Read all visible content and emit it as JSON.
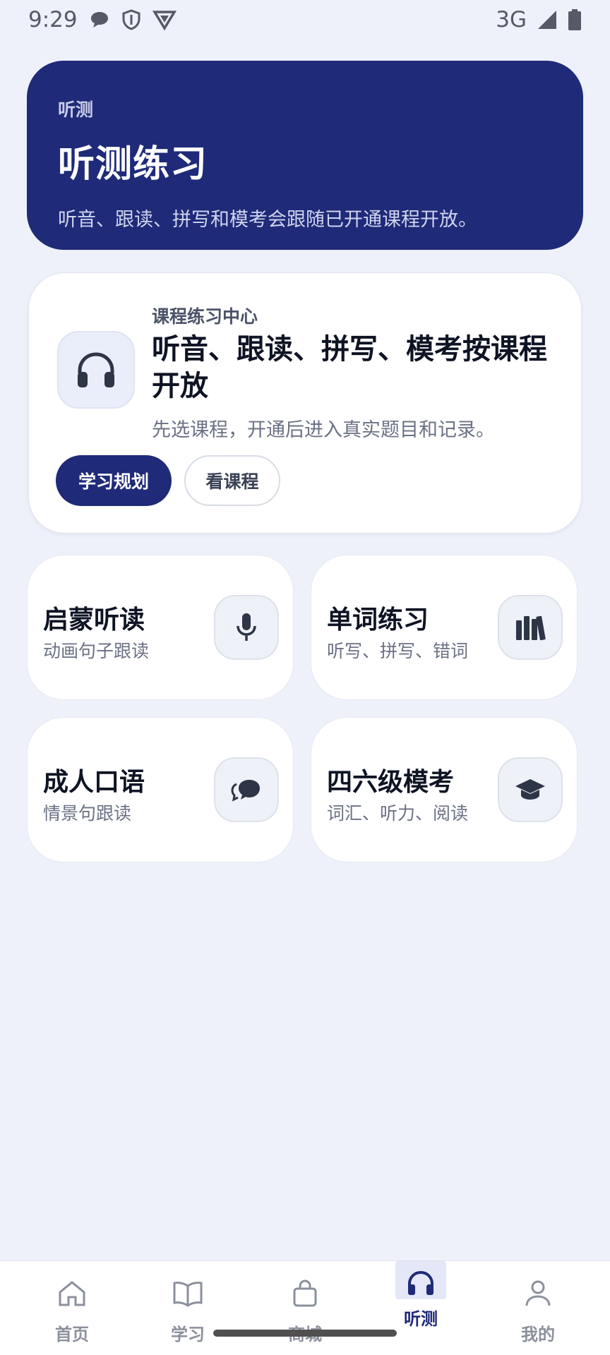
{
  "status_bar": {
    "time": "9:29",
    "network": "3G",
    "icons": [
      "chat-bubble-icon",
      "shield-icon",
      "vpn-icon",
      "signal-icon",
      "battery-icon"
    ]
  },
  "hero": {
    "tag": "听测",
    "title": "听测练习",
    "subtitle": "听音、跟读、拼写和模考会跟随已开通课程开放。"
  },
  "center_card": {
    "icon": "headphones-icon",
    "eyebrow": "课程练习中心",
    "title": "听音、跟读、拼写、模考按课程开放",
    "subtitle": "先选课程，开通后进入真实题目和记录。",
    "primary_button": "学习规划",
    "secondary_button": "看课程"
  },
  "practice_cards": [
    {
      "title": "启蒙听读",
      "subtitle": "动画句子跟读",
      "icon": "microphone-icon"
    },
    {
      "title": "单词练习",
      "subtitle": "听写、拼写、错词",
      "icon": "books-icon"
    },
    {
      "title": "成人口语",
      "subtitle": "情景句跟读",
      "icon": "chat-icon"
    },
    {
      "title": "四六级模考",
      "subtitle": "词汇、听力、阅读",
      "icon": "graduation-cap-icon"
    }
  ],
  "bottom_nav": [
    {
      "label": "首页",
      "icon": "home-icon",
      "active": false
    },
    {
      "label": "学习",
      "icon": "book-icon",
      "active": false
    },
    {
      "label": "商城",
      "icon": "shopping-bag-icon",
      "active": false
    },
    {
      "label": "听测",
      "icon": "headphones-icon",
      "active": true
    },
    {
      "label": "我的",
      "icon": "person-icon",
      "active": false
    }
  ],
  "colors": {
    "background": "#eef1fa",
    "primary": "#1f2a78",
    "card": "#ffffff"
  }
}
